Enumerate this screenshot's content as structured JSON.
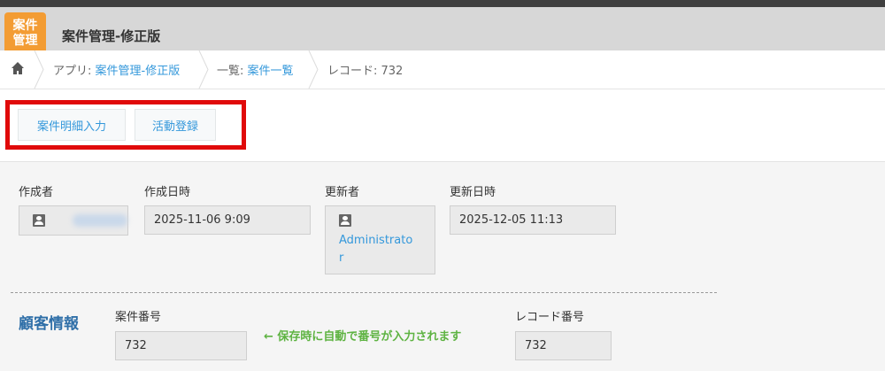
{
  "header": {
    "app_icon_line1": "案件",
    "app_icon_line2": "管理",
    "title": "案件管理-修正版"
  },
  "breadcrumb": {
    "app_prefix": "アプリ: ",
    "app_link": "案件管理-修正版",
    "list_prefix": "一覧: ",
    "list_link": "案件一覧",
    "record": "レコード: 732"
  },
  "buttons": {
    "detail_input": "案件明細入力",
    "activity_register": "活動登録"
  },
  "record_meta": {
    "creator_label": "作成者",
    "created_at_label": "作成日時",
    "created_at": "2025-11-06 9:09",
    "updater_label": "更新者",
    "updater_line1": "Administrato",
    "updater_line2": "r",
    "updated_at_label": "更新日時",
    "updated_at": "2025-12-05 11:13"
  },
  "customer_section": {
    "title": "顧客情報",
    "case_number_label": "案件番号",
    "case_number": "732",
    "hint": "← 保存時に自動で番号が入力されます",
    "record_number_label": "レコード番号",
    "record_number": "732"
  },
  "colors": {
    "accent": "#3498db",
    "app_icon": "#f39c33",
    "highlight_box": "#e00a0a",
    "hint": "#5eb342"
  },
  "icons": [
    "home-icon",
    "user-icon"
  ]
}
